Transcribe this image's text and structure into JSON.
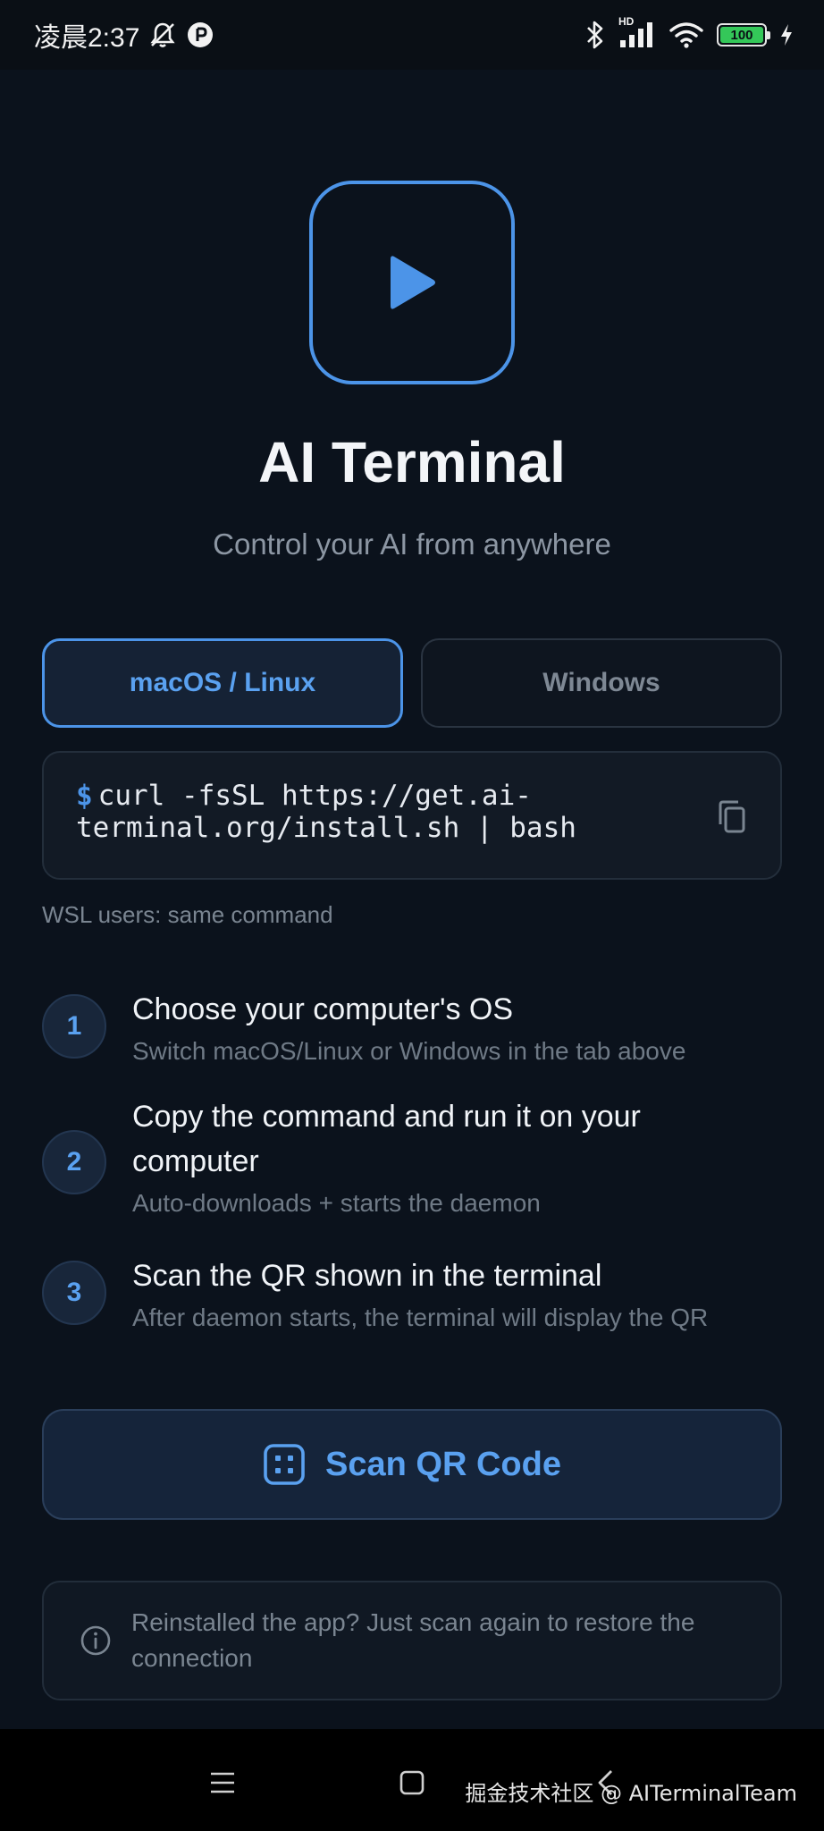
{
  "status_bar": {
    "time": "凌晨2:37",
    "network_badge": "HD",
    "battery_level": "100",
    "icons": [
      "bell-muted-icon",
      "app-notification-icon",
      "bluetooth-icon",
      "signal-icon",
      "wifi-icon",
      "battery-icon",
      "charging-icon"
    ]
  },
  "header": {
    "logo_icon": "play-icon",
    "title": "AI Terminal",
    "subtitle": "Control your AI from anywhere"
  },
  "os_tabs": {
    "items": [
      {
        "label": "macOS / Linux",
        "selected": true
      },
      {
        "label": "Windows",
        "selected": false
      }
    ]
  },
  "command": {
    "prompt": "$",
    "text": "curl -fsSL https://get.ai-terminal.org/install.sh | bash",
    "copy_icon": "copy-icon",
    "note": "WSL users: same command"
  },
  "steps": [
    {
      "number": "1",
      "title": "Choose your computer's OS",
      "description": "Switch macOS/Linux or Windows in the tab above"
    },
    {
      "number": "2",
      "title": "Copy the command and run it on your computer",
      "description": "Auto-downloads + starts the daemon"
    },
    {
      "number": "3",
      "title": "Scan the QR shown in the terminal",
      "description": "After daemon starts, the terminal will display the QR"
    }
  ],
  "scan_button": {
    "label": "Scan QR Code",
    "icon": "qr-scan-icon"
  },
  "info": {
    "icon": "info-icon",
    "text": "Reinstalled the app? Just scan again to restore the connection"
  },
  "nav_bar": {
    "buttons": [
      "menu-icon",
      "home-icon",
      "back-icon"
    ]
  },
  "watermark": "掘金技术社区 @ AITerminalTeam",
  "colors": {
    "background": "#0b121c",
    "accent": "#4c94e8",
    "card": "#121a25"
  }
}
